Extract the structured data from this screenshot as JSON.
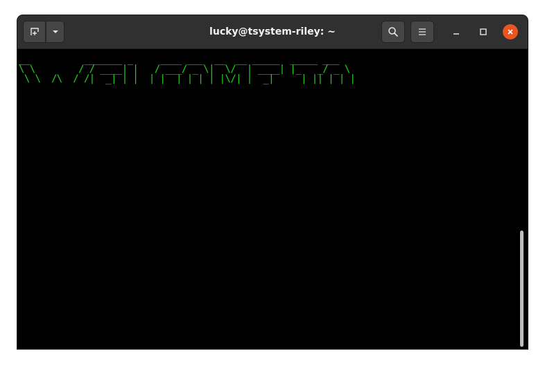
{
  "window": {
    "title": "lucky@tsystem-riley: ~"
  },
  "header": {
    "new_tab_icon": "new-tab-icon",
    "dropdown_icon": "chevron-down-icon",
    "search_icon": "search-icon",
    "menu_icon": "hamburger-menu-icon",
    "minimize_icon": "minimize-icon",
    "maximize_icon": "maximize-icon",
    "close_icon": "close-icon"
  },
  "terminal": {
    "banner_lines": [
      "__          _______ _     ____ ___  __  __ _____  _____ ___",
      "\\ \\        / / ____| |   / ___/ _ \\|  \\/  | ____| |_   _/ _ \\",
      " \\ \\  /\\  / /|  _| | |  | |  | | | | |\\/| |  _|     | || | | |"
    ]
  },
  "colors": {
    "titlebar": "#303030",
    "terminal_bg": "#000000",
    "terminal_text": "#22d41c",
    "close_accent": "#e95420"
  }
}
